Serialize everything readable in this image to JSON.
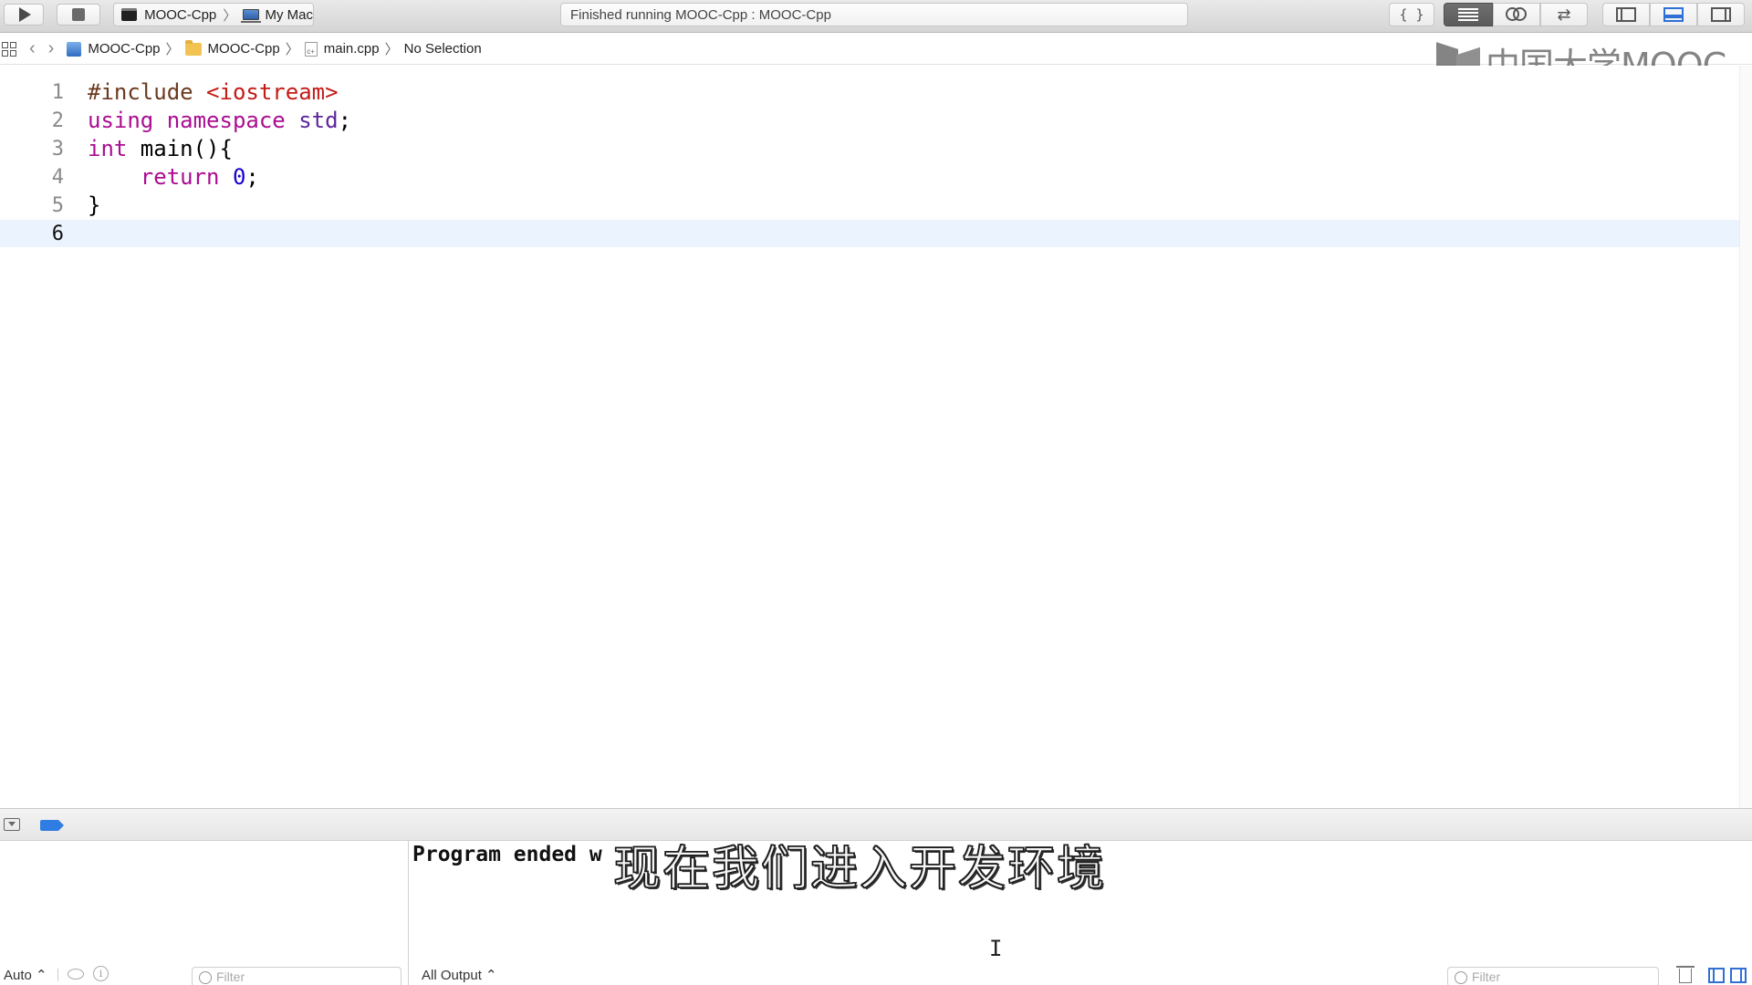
{
  "toolbar": {
    "run_icon": "play-icon",
    "stop_icon": "stop-icon",
    "scheme": {
      "target": "MOOC-Cpp",
      "destination": "My Mac"
    },
    "activity_text": "Finished running MOOC-Cpp : MOOC-Cpp",
    "braces_label": "{ }"
  },
  "jumpbar": {
    "items": [
      "MOOC-Cpp",
      "MOOC-Cpp",
      "main.cpp",
      "No Selection"
    ]
  },
  "watermark": {
    "text": "中国大学MOOC"
  },
  "editor": {
    "line_numbers": [
      "1",
      "2",
      "3",
      "4",
      "5",
      "6"
    ],
    "current_line": "6",
    "lines": [
      [
        {
          "t": "#include ",
          "c": "pre"
        },
        {
          "t": "<iostream>",
          "c": "str"
        }
      ],
      [
        {
          "t": "using",
          "c": "kw"
        },
        {
          "t": " ",
          "c": ""
        },
        {
          "t": "namespace",
          "c": "kw"
        },
        {
          "t": " ",
          "c": ""
        },
        {
          "t": "std",
          "c": "typ"
        },
        {
          "t": ";",
          "c": ""
        }
      ],
      [
        {
          "t": "int",
          "c": "kw"
        },
        {
          "t": " main(){",
          "c": ""
        }
      ],
      [
        {
          "t": "    ",
          "c": ""
        },
        {
          "t": "return",
          "c": "kw"
        },
        {
          "t": " ",
          "c": ""
        },
        {
          "t": "0",
          "c": "num"
        },
        {
          "t": ";",
          "c": ""
        }
      ],
      [
        {
          "t": "}",
          "c": ""
        }
      ],
      []
    ],
    "colors": {
      "keyword": "#aa0d91",
      "string": "#c41a16",
      "type": "#5c2699",
      "number": "#1c00cf",
      "preprocessor": "#6b3a1e",
      "current_line_bg": "#ebf3fe"
    }
  },
  "debug": {
    "console_output": "Program ended w",
    "subtitle": "现在我们进入开发环境",
    "variables_view_mode": "Auto ⌃",
    "filter_placeholder": "Filter",
    "output_selector": "All Output ⌃",
    "info_glyph": "i"
  }
}
